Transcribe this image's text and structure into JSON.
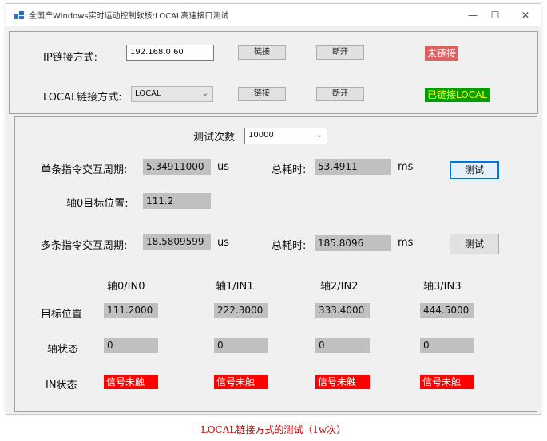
{
  "window": {
    "title": "全国产Windows实时运动控制软核:LOCAL高速接口测试",
    "controls": {
      "minimize": "—",
      "maximize": "☐",
      "close": "✕"
    }
  },
  "connection": {
    "ip_label": "IP链接方式:",
    "ip_value": "192.168.0.60",
    "ip_connect": "链接",
    "ip_disconnect": "断开",
    "ip_status": "未链接",
    "local_label": "LOCAL链接方式:",
    "local_value": "LOCAL",
    "local_connect": "链接",
    "local_disconnect": "断开",
    "local_status": "已链接LOCAL"
  },
  "test": {
    "count_label": "测试次数",
    "count_value": "10000",
    "single_label": "单条指令交互周期:",
    "single_value": "5.34911000",
    "single_unit": "us",
    "single_total_label": "总耗时:",
    "single_total_value": "53.4911",
    "single_total_unit": "ms",
    "single_test_button": "测试",
    "axis0_target_label": "轴0目标位置:",
    "axis0_target_value": "111.2",
    "multi_label": "多条指令交互周期:",
    "multi_value": "18.5809599",
    "multi_unit": "us",
    "multi_total_label": "总耗时:",
    "multi_total_value": "185.8096",
    "multi_total_unit": "ms",
    "multi_test_button": "测试"
  },
  "axes": {
    "row_labels": {
      "target": "目标位置",
      "state": "轴状态",
      "in": "IN状态"
    },
    "columns": [
      {
        "header": "轴0/IN0",
        "target": "111.2000",
        "state": "0",
        "in": "信号未触"
      },
      {
        "header": "轴1/IN1",
        "target": "222.3000",
        "state": "0",
        "in": "信号未触"
      },
      {
        "header": "轴2/IN2",
        "target": "333.4000",
        "state": "0",
        "in": "信号未触"
      },
      {
        "header": "轴3/IN3",
        "target": "444.5000",
        "state": "0",
        "in": "信号未触"
      }
    ]
  },
  "caption": "LOCAL链接方式的测试（1w次）",
  "colors": {
    "status_red_bg": "#e06060",
    "status_red_fg": "#ffffff",
    "status_green_bg": "#00a000",
    "status_green_fg": "#ffff00",
    "in_label_bg": "#ff0000",
    "caption": "#c00000"
  }
}
